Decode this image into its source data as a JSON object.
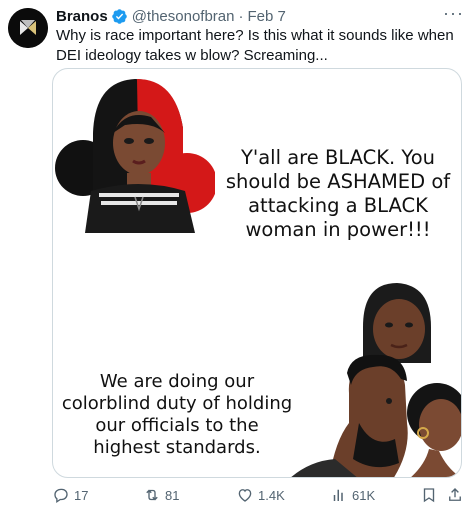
{
  "author": {
    "name": "Branos",
    "handle": "@thesonofbran",
    "separator": "·",
    "date": "Feb 7"
  },
  "more_label": "···",
  "tweet": {
    "text": "Why is race important here?  Is this what it sounds like when DEI ideology takes w blow?  Screaming..."
  },
  "media": {
    "caption_top": "Y'all are BLACK.  You should be ASHAMED of attacking a BLACK woman in power!!!",
    "caption_bottom": "We are doing our colorblind duty of holding our officials to the highest standards."
  },
  "actions": {
    "replies": "17",
    "reposts": "81",
    "likes": "1.4K",
    "views": "61K"
  },
  "colors": {
    "verified_blue": "#1d9bf0",
    "secondary_text": "#536471",
    "border": "#cfd9de"
  }
}
